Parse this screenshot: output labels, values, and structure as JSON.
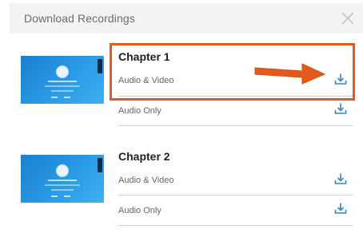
{
  "header": {
    "title": "Download Recordings"
  },
  "chapters": [
    {
      "title": "Chapter 1",
      "rows": [
        {
          "label": "Audio & Video"
        },
        {
          "label": "Audio Only"
        }
      ]
    },
    {
      "title": "Chapter 2",
      "rows": [
        {
          "label": "Audio & Video"
        },
        {
          "label": "Audio Only"
        }
      ]
    }
  ],
  "colors": {
    "accent": "#2e86c9",
    "highlight": "#e35a1c",
    "header_bg": "#f3f3f3"
  },
  "icons": [
    "close-icon",
    "download-icon",
    "arrow-annotation-icon"
  ]
}
